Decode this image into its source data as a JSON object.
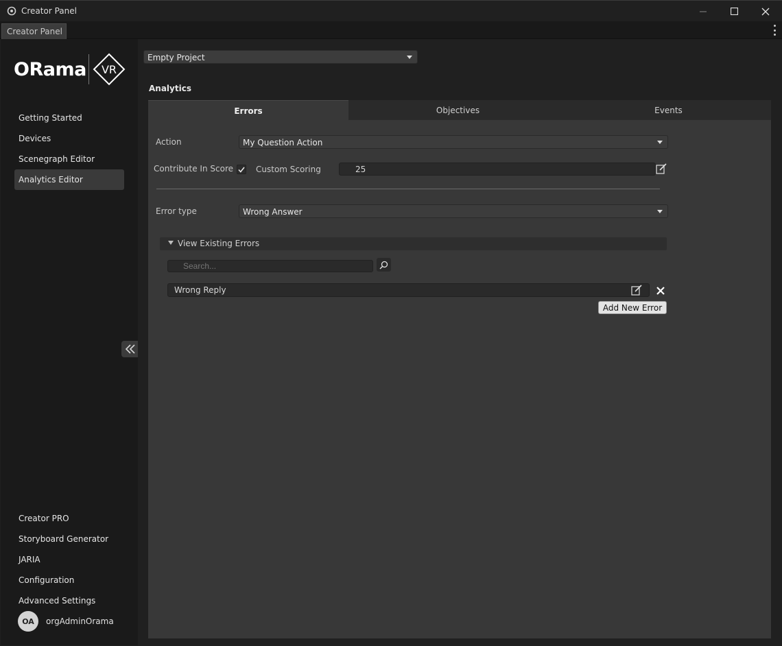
{
  "window": {
    "title": "Creator Panel"
  },
  "tabstrip": {
    "tab_label": "Creator Panel"
  },
  "logo": {
    "text": "ORama",
    "mark": "VR"
  },
  "sidebar": {
    "items": [
      {
        "label": "Getting Started"
      },
      {
        "label": "Devices"
      },
      {
        "label": "Scenegraph Editor"
      },
      {
        "label": "Analytics Editor",
        "active": true
      }
    ],
    "bottom_items": [
      {
        "label": "Creator PRO"
      },
      {
        "label": "Storyboard Generator"
      },
      {
        "label": "JARIA"
      },
      {
        "label": "Configuration"
      },
      {
        "label": "Advanced Settings"
      }
    ],
    "user": {
      "initials": "OA",
      "name": "orgAdminOrama"
    }
  },
  "main": {
    "project_select": {
      "value": "Empty Project"
    },
    "section_title": "Analytics",
    "tabs": [
      {
        "label": "Errors",
        "active": true
      },
      {
        "label": "Objectives"
      },
      {
        "label": "Events"
      }
    ],
    "form": {
      "action_label": "Action",
      "action_value": "My Question Action",
      "contribute_label": "Contribute In Score",
      "contribute_checked": true,
      "custom_scoring_label": "Custom Scoring",
      "custom_scoring_value": "25",
      "error_type_label": "Error type",
      "error_type_value": "Wrong Answer"
    },
    "existing_errors": {
      "foldout_label": "View Existing Errors",
      "search_placeholder": "Search...",
      "items": [
        {
          "label": "Wrong Reply"
        }
      ],
      "add_button": "Add New Error"
    }
  },
  "colors": {
    "background": "#202020",
    "sidebar": "#1a1a1a",
    "panel": "#383838",
    "accent_active": "#3a3a3a"
  }
}
